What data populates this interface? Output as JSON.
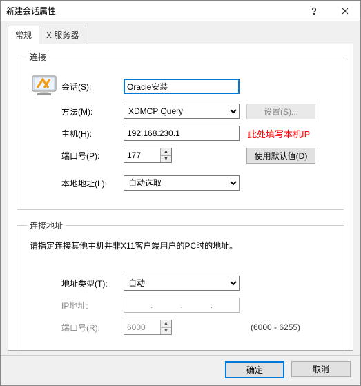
{
  "window": {
    "title": "新建会话属性"
  },
  "tabs": {
    "general": "常规",
    "xserver": "X 服务器"
  },
  "group_conn": {
    "legend": "连接",
    "session_label": "会话(S):",
    "session_value": "Oracle安装",
    "method_label": "方法(M):",
    "method_value": "XDMCP Query",
    "settings_btn": "设置(S)...",
    "host_label": "主机(H):",
    "host_value": "192.168.230.1",
    "host_annot": "此处填写本机IP",
    "port_label": "端口号(P):",
    "port_value": "177",
    "default_btn": "使用默认值(D)",
    "local_label": "本地地址(L):",
    "local_value": "自动选取"
  },
  "group_addr": {
    "legend": "连接地址",
    "desc": "请指定连接其他主机并非X11客户端用户的PC时的地址。",
    "type_label": "地址类型(T):",
    "type_value": "自动",
    "ip_label": "IP地址:",
    "port_label": "端口号(R):",
    "port_value": "6000",
    "port_range": "(6000 - 6255)"
  },
  "footer": {
    "ok": "确定",
    "cancel": "取消"
  }
}
